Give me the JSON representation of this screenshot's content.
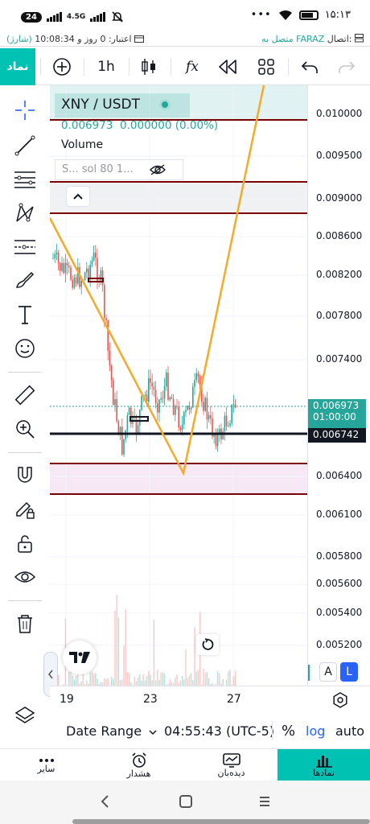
{
  "status_bar": {
    "notification_count": "24",
    "network": "4.5G",
    "time": "۱۵:۱۳",
    "dots": "•••"
  },
  "connection_bar": {
    "credit_prefix": "(شارژ)",
    "credit_text": "اعتبار: 0 روز و 10:08:34",
    "connection_label": "اتصال:",
    "connection_status": "متصل به FARAZ"
  },
  "toolbar": {
    "symbols_label": "نماد",
    "interval": "1h",
    "indicators_label": "fx"
  },
  "legend": {
    "symbol": "XNY / USDT",
    "price": "0.006973",
    "change": "0.000000",
    "change_pct": "(0.00%)",
    "volume_label": "Volume",
    "indicator_label": "S... sol 80 1..."
  },
  "price_scale": {
    "labels": [
      "0.010000",
      "0.009500",
      "0.009000",
      "0.008600",
      "0.008200",
      "0.007800",
      "0.007400",
      "0.006400",
      "0.006100",
      "0.005800",
      "0.005600",
      "0.005400",
      "0.005200"
    ],
    "current_price": "0.006973",
    "countdown": "01:00:00",
    "line_price": "0.006742",
    "current_color": "#26a69a",
    "line_color": "#131722"
  },
  "time_axis": {
    "labels": [
      "19",
      "23",
      "27"
    ]
  },
  "scale_buttons": {
    "a": "A",
    "l": "L"
  },
  "controls": {
    "date_range": "Date Range",
    "time": "04:55:43 (UTC-5)",
    "percent": "%",
    "log": "log",
    "auto": "auto"
  },
  "bottom_nav": {
    "items": [
      "سایر",
      "هشدار",
      "دیده‌بان",
      "نمادها"
    ]
  },
  "colors": {
    "accent": "#00c2b2",
    "up": "#26a69a",
    "down": "#ef5350",
    "trendline": "#f7a928",
    "zone_line": "#7b0000"
  }
}
